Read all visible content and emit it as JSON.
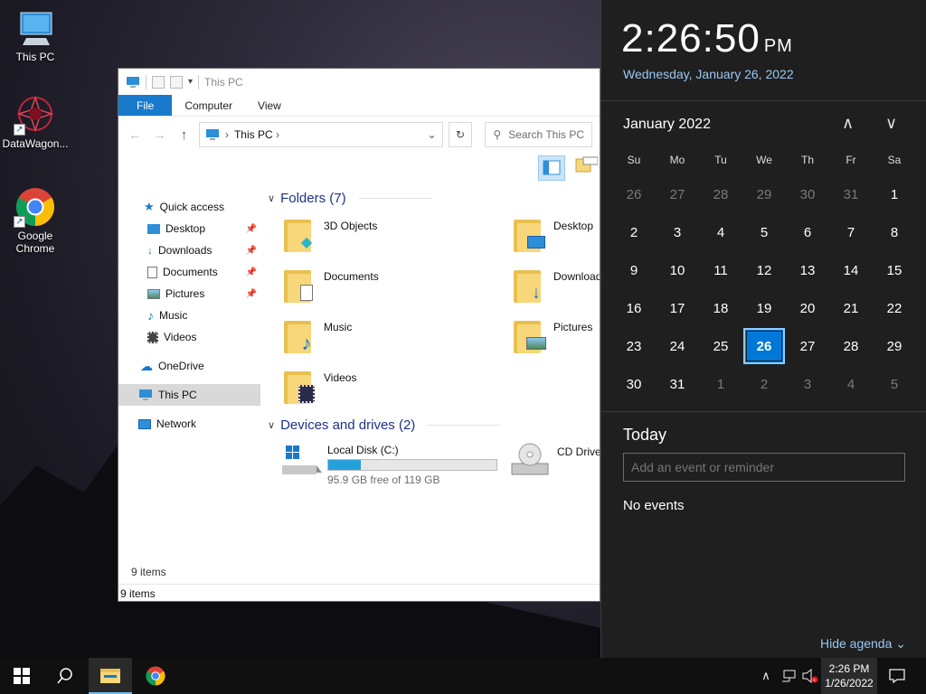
{
  "desktop": {
    "icons": [
      {
        "label": "This PC"
      },
      {
        "label": "DataWagon..."
      },
      {
        "label": "Google Chrome"
      }
    ]
  },
  "explorer": {
    "title": "This PC",
    "ribbon_tabs": [
      "File",
      "Computer",
      "View"
    ],
    "address": "This PC",
    "search_placeholder": "Search This PC",
    "nav": {
      "quick_access": "Quick access",
      "items": [
        "Desktop",
        "Downloads",
        "Documents",
        "Pictures",
        "Music",
        "Videos"
      ],
      "onedrive": "OneDrive",
      "this_pc": "This PC",
      "network": "Network"
    },
    "folders_header": "Folders (7)",
    "folders": [
      "3D Objects",
      "Desktop",
      "Documents",
      "Downloads",
      "Music",
      "Pictures",
      "Videos"
    ],
    "devices_header": "Devices and drives (2)",
    "local_disk": {
      "name": "Local Disk (C:)",
      "free_text": "95.9 GB free of 119 GB",
      "used_fraction": 0.194
    },
    "cd_drive": "CD Drive",
    "status_items": "9 items",
    "status_bar": "9 items"
  },
  "calendar": {
    "time": "2:26:50",
    "ampm": "PM",
    "date": "Wednesday, January 26, 2022",
    "month": "January 2022",
    "weekdays": [
      "Su",
      "Mo",
      "Tu",
      "We",
      "Th",
      "Fr",
      "Sa"
    ],
    "weeks": [
      [
        "26",
        "27",
        "28",
        "29",
        "30",
        "31",
        "1"
      ],
      [
        "2",
        "3",
        "4",
        "5",
        "6",
        "7",
        "8"
      ],
      [
        "9",
        "10",
        "11",
        "12",
        "13",
        "14",
        "15"
      ],
      [
        "16",
        "17",
        "18",
        "19",
        "20",
        "21",
        "22"
      ],
      [
        "23",
        "24",
        "25",
        "26",
        "27",
        "28",
        "29"
      ],
      [
        "30",
        "31",
        "1",
        "2",
        "3",
        "4",
        "5"
      ]
    ],
    "selected_day": "26",
    "today_label": "Today",
    "event_placeholder": "Add an event or reminder",
    "no_events": "No events",
    "hide_agenda": "Hide agenda"
  },
  "taskbar": {
    "time": "2:26 PM",
    "date": "1/26/2022"
  },
  "colors": {
    "accent": "#0078d7",
    "file_tab": "#1979ca",
    "drive_fill": "#26a0da"
  }
}
